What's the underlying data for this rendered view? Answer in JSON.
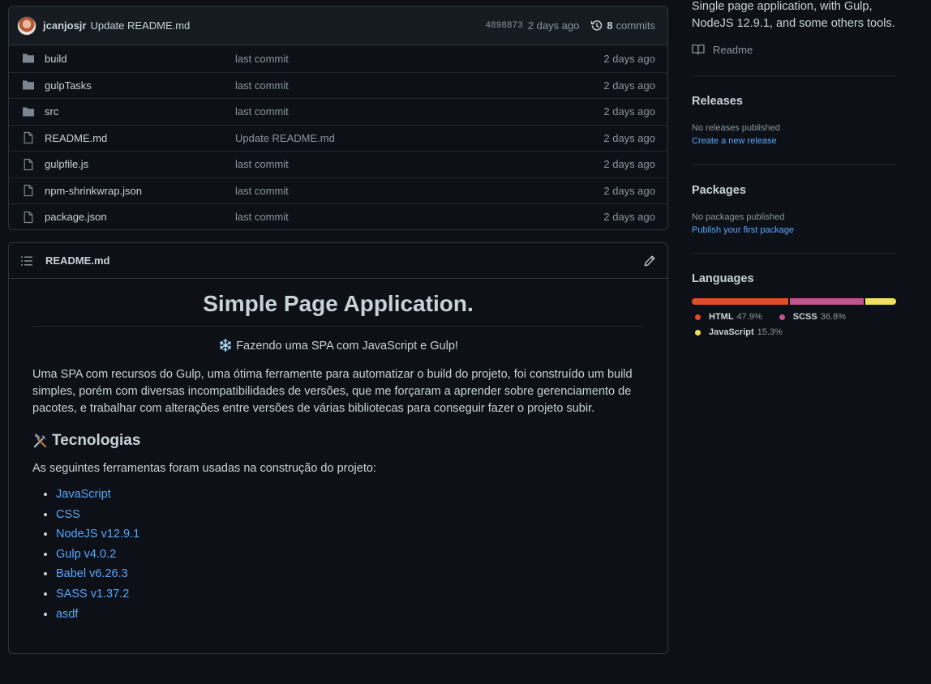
{
  "latest_commit": {
    "author": "jcanjosjr",
    "message": "Update README.md",
    "sha": "4898873",
    "age": "2 days ago",
    "commit_count": "8",
    "commits_label": "commits"
  },
  "files": [
    {
      "name": "build",
      "type": "folder",
      "commit": "last commit",
      "age": "2 days ago"
    },
    {
      "name": "gulpTasks",
      "type": "folder",
      "commit": "last commit",
      "age": "2 days ago"
    },
    {
      "name": "src",
      "type": "folder",
      "commit": "last commit",
      "age": "2 days ago"
    },
    {
      "name": "README.md",
      "type": "file",
      "commit": "Update README.md",
      "age": "2 days ago"
    },
    {
      "name": "gulpfile.js",
      "type": "file",
      "commit": "last commit",
      "age": "2 days ago"
    },
    {
      "name": "npm-shrinkwrap.json",
      "type": "file",
      "commit": "last commit",
      "age": "2 days ago"
    },
    {
      "name": "package.json",
      "type": "file",
      "commit": "last commit",
      "age": "2 days ago"
    }
  ],
  "readme": {
    "filename": "README.md",
    "h1": "Simple Page Application.",
    "subtitle": "❄️ Fazendo uma SPA com JavaScript e Gulp!",
    "intro": "Uma SPA com recursos do Gulp, uma ótima ferramente para automatizar o build do projeto, foi construído um build simples, porém com diversas incompatibilidades de versões, que me forçaram a aprender sobre gerenciamento de pacotes, e trabalhar com alterações entre versões de várias bibliotecas para conseguir fazer o projeto subir.",
    "tech_heading": "Tecnologias",
    "tech_intro": "As seguintes ferramentas foram usadas na construção do projeto:",
    "tech_list": [
      "JavaScript",
      "CSS",
      "NodeJS v12.9.1",
      "Gulp v4.0.2",
      "Babel v6.26.3",
      "SASS v1.37.2",
      "asdf"
    ]
  },
  "sidebar": {
    "about_text": "Single page application, with Gulp, NodeJS 12.9.1, and some others tools.",
    "readme_link": "Readme",
    "releases": {
      "heading": "Releases",
      "status": "No releases published",
      "link": "Create a new release"
    },
    "packages": {
      "heading": "Packages",
      "status": "No packages published",
      "link": "Publish your first package"
    },
    "languages": {
      "heading": "Languages",
      "items": [
        {
          "name": "HTML",
          "percent": "47.9%",
          "value": 47.9,
          "color": "#e34c26"
        },
        {
          "name": "SCSS",
          "percent": "36.8%",
          "value": 36.8,
          "color": "#c6538c"
        },
        {
          "name": "JavaScript",
          "percent": "15.3%",
          "value": 15.3,
          "color": "#f1e05a"
        }
      ]
    }
  }
}
